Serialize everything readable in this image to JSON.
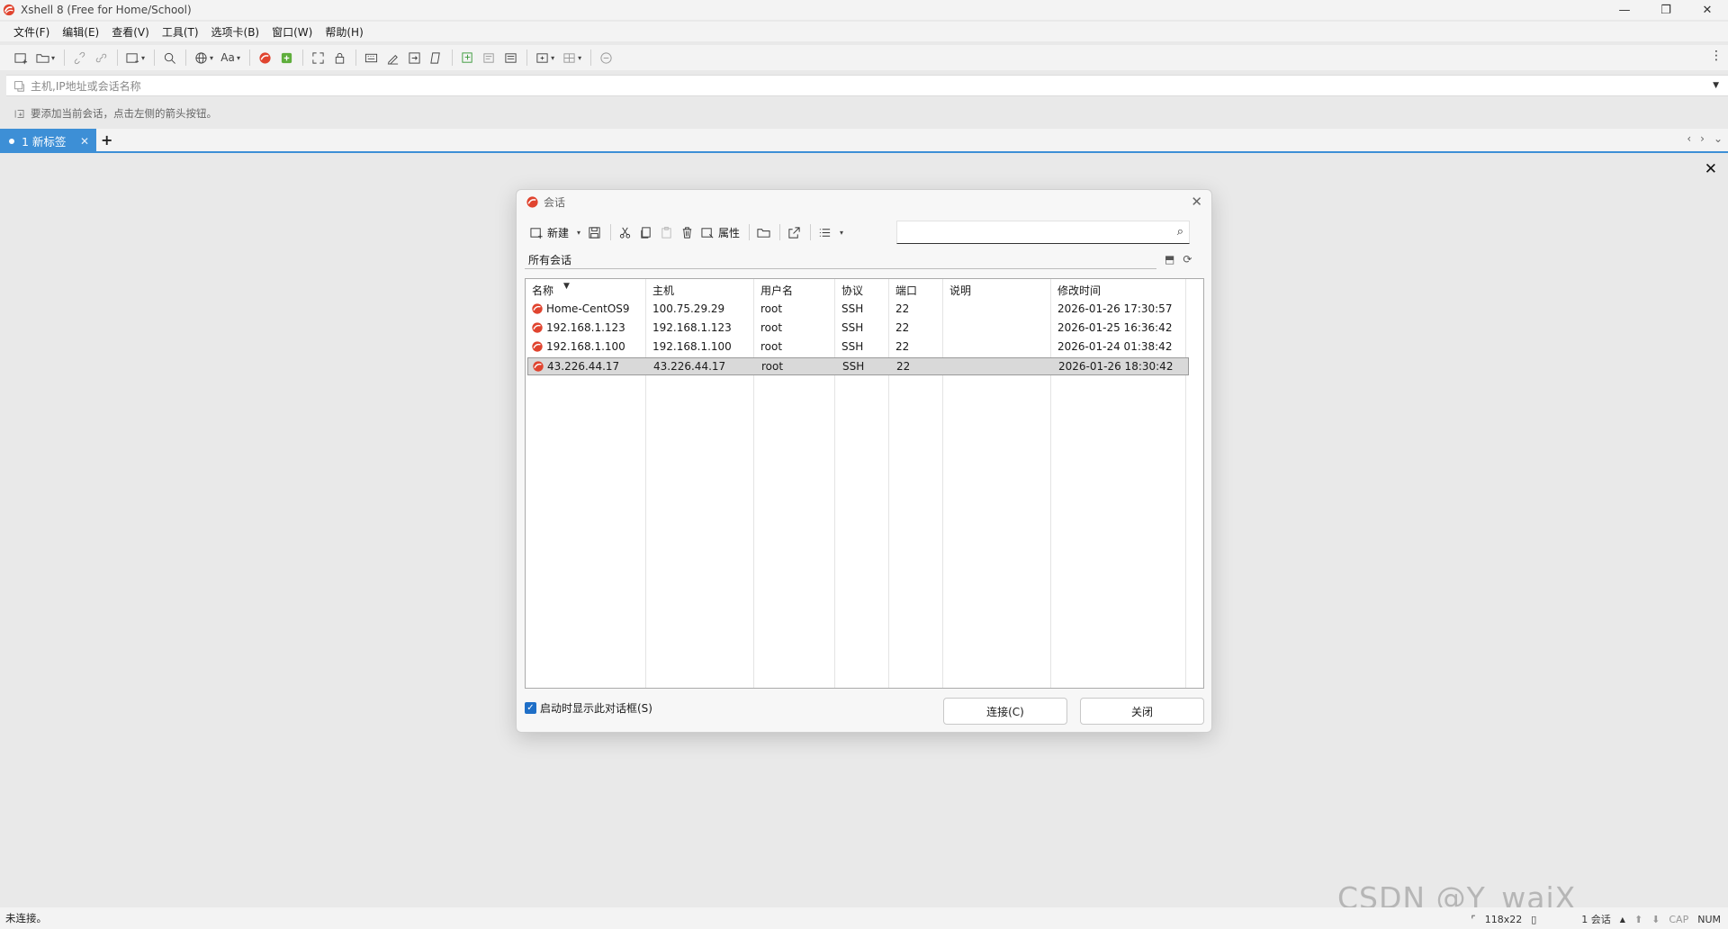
{
  "window": {
    "title": "Xshell 8 (Free for Home/School)",
    "minimize": "—",
    "restore": "❐",
    "close": "✕"
  },
  "menu": [
    "文件(F)",
    "编辑(E)",
    "查看(V)",
    "工具(T)",
    "选项卡(B)",
    "窗口(W)",
    "帮助(H)"
  ],
  "address": {
    "placeholder": "主机,IP地址或会话名称"
  },
  "hint": {
    "text": "要添加当前会话，点击左侧的箭头按钮。"
  },
  "tabs": [
    {
      "label": "1 新标签"
    }
  ],
  "tab_add": "+",
  "dialog": {
    "title": "会话",
    "toolbar": {
      "new_label": "新建",
      "properties_label": "属性"
    },
    "folder_path": "所有会话",
    "columns": [
      "名称",
      "主机",
      "用户名",
      "协议",
      "端口",
      "说明",
      "修改时间"
    ],
    "rows": [
      {
        "name": "Home-CentOS9",
        "host": "100.75.29.29",
        "user": "root",
        "protocol": "SSH",
        "port": "22",
        "desc": "",
        "modified": "2026-01-26 17:30:57",
        "selected": false
      },
      {
        "name": "192.168.1.123",
        "host": "192.168.1.123",
        "user": "root",
        "protocol": "SSH",
        "port": "22",
        "desc": "",
        "modified": "2026-01-25 16:36:42",
        "selected": false
      },
      {
        "name": "192.168.1.100",
        "host": "192.168.1.100",
        "user": "root",
        "protocol": "SSH",
        "port": "22",
        "desc": "",
        "modified": "2026-01-24 01:38:42",
        "selected": false
      },
      {
        "name": "43.226.44.17",
        "host": "43.226.44.17",
        "user": "root",
        "protocol": "SSH",
        "port": "22",
        "desc": "",
        "modified": "2026-01-26 18:30:42",
        "selected": true
      }
    ],
    "show_on_startup_label": "启动时显示此对话框(S)",
    "show_on_startup_checked": true,
    "connect_label": "连接(C)",
    "close_label": "关闭"
  },
  "status": {
    "left": "未连接。",
    "size": "118x22",
    "sessions": "1 会话",
    "cap": "CAP",
    "num": "NUM"
  },
  "watermark": "CSDN @Y_waiX",
  "colors": {
    "accent": "#3d8fd6",
    "brand": "#e0442f"
  }
}
